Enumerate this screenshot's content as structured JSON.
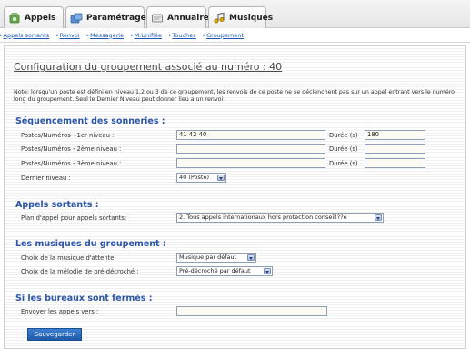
{
  "tabs": [
    {
      "label": "Appels",
      "icon": "phone-icon"
    },
    {
      "label": "Paramétrages",
      "icon": "settings-icon"
    },
    {
      "label": "Annuaire",
      "icon": "directory-icon"
    },
    {
      "label": "Musiques",
      "icon": "music-icon"
    }
  ],
  "subnav": [
    "Appels sortants",
    "Renvoi",
    "Messagerie",
    "M.Unifiée",
    "Touches",
    "Groupement"
  ],
  "page_title": "Configuration du groupement associé au numéro : 40",
  "note": "Note: lorsqu'un poste est défini en niveau 1,2 ou 3 de ce groupement, les renvois de ce poste ne se déclenchent pas sur un appel entrant vers le numéro long du groupement. Seul le Dernier Niveau peut donner lieu a un renvoi",
  "sequencement": {
    "title": "Séquencement des sonneries :",
    "rows": [
      {
        "label": "Postes/Numéros - 1er niveau :",
        "value": "41 42 40",
        "duree_label": "Durée (s)",
        "duree": "180"
      },
      {
        "label": "Postes/Numéros - 2ème niveau :",
        "value": "",
        "duree_label": "Durée (s)",
        "duree": ""
      },
      {
        "label": "Postes/Numéros - 3ème niveau :",
        "value": "",
        "duree_label": "Durée (s)",
        "duree": ""
      }
    ],
    "dernier_label": "Dernier niveau :",
    "dernier_value": "40 (Poste)"
  },
  "appels_sortants": {
    "title": "Appels sortants :",
    "label": "Plan d'appel pour appels sortants:",
    "value": "2. Tous appels internationaux hors protection conseill??e"
  },
  "musiques": {
    "title": "Les musiques du groupement :",
    "attente_label": "Choix de la musique d'attente",
    "attente_value": "Musique par défaut",
    "predecroche_label": "Choix de la mélodie de pré-décroché :",
    "predecroche_value": "Pré-décroché par défaut"
  },
  "bureaux": {
    "title": "Si les bureaux sont fermés :",
    "label": "Envoyer les appels vers :",
    "value": ""
  },
  "save_label": "Sauvegarder",
  "colors": {
    "accent": "#2c56a8",
    "link": "#1a57b0",
    "button": "#2a6bc0"
  }
}
